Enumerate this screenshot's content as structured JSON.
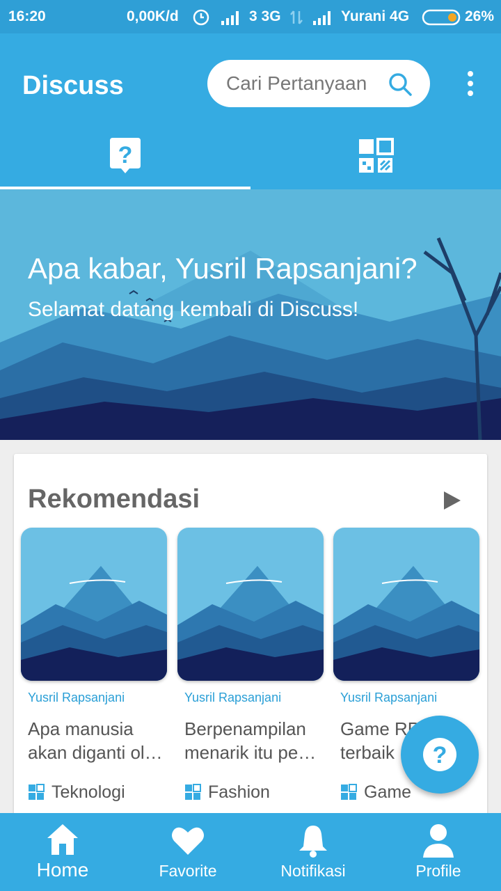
{
  "status_bar": {
    "time": "16:20",
    "speed": "0,00K/d",
    "network1": "3 3G",
    "network2": "Yurani 4G",
    "battery": "26%"
  },
  "app_bar": {
    "title": "Discuss",
    "search_placeholder": "Cari Pertanyaan"
  },
  "tabs": [
    {
      "icon": "question-tab-icon",
      "selected": true
    },
    {
      "icon": "category-grid-icon",
      "selected": false
    }
  ],
  "banner": {
    "greeting": "Apa kabar, Yusril Rapsanjani?",
    "subtitle": "Selamat datang kembali di Discuss!"
  },
  "recommendations": {
    "title": "Rekomendasi",
    "items": [
      {
        "author": "Yusril Rapsanjani",
        "line1": "Apa manusia",
        "line2": "akan diganti ol…",
        "category": "Teknologi"
      },
      {
        "author": "Yusril Rapsanjani",
        "line1": "Berpenampilan",
        "line2": "menarik itu pe…",
        "category": "Fashion"
      },
      {
        "author": "Yusril Rapsanjani",
        "line1": "Game RP",
        "line2": "terbaik",
        "category": "Game"
      }
    ]
  },
  "bottom_nav": [
    {
      "label": "Home",
      "icon": "home-icon",
      "active": true
    },
    {
      "label": "Favorite",
      "icon": "heart-icon",
      "active": false
    },
    {
      "label": "Notifikasi",
      "icon": "bell-icon",
      "active": false
    },
    {
      "label": "Profile",
      "icon": "profile-icon",
      "active": false
    }
  ],
  "colors": {
    "primary": "#35abe2",
    "status_bar": "#2f9fd6",
    "author_text": "#2a9fd6"
  }
}
